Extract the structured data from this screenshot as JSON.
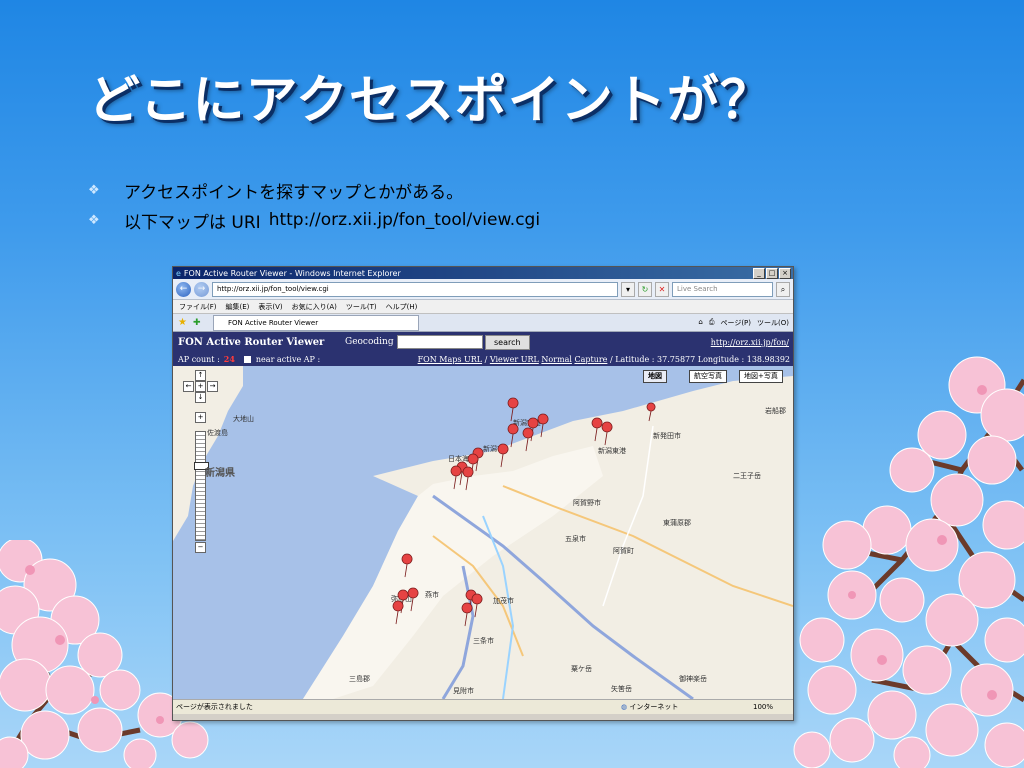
{
  "slide": {
    "title": "どこにアクセスポイントが？",
    "bullets": [
      {
        "text": "アクセスポイントを探すマップとかがある。"
      },
      {
        "text": "以下マップは URI",
        "link": "http://orz.xii.jp/fon_tool/view.cgi"
      }
    ]
  },
  "browser": {
    "window_title": "FON Active Router Viewer - Windows Internet Explorer",
    "address": "http://orz.xii.jp/fon_tool/view.cgi",
    "search_placeholder": "Live Search",
    "menu": [
      "ファイル(F)",
      "編集(E)",
      "表示(V)",
      "お気に入り(A)",
      "ツール(T)",
      "ヘルプ(H)"
    ],
    "tab_label": "FON Active Router Viewer",
    "command_bar": [
      "ページ(P)",
      "ツール(O)"
    ],
    "status_text": "ページが表示されました",
    "status_zone": "インターネット",
    "status_zoom": "100%"
  },
  "fon": {
    "title": "FON Active Router Viewer",
    "geocoding_label": "Geocoding :",
    "search_button": "search",
    "site_url": "http://orz.xii.jp/fon/",
    "ap_count_label": "AP count :",
    "ap_count": "24",
    "near_label": "near active AP :",
    "maps_url": "FON Maps URL",
    "viewer_url": "Viewer URL",
    "normal": "Normal",
    "capture": "Capture",
    "latitude": "Latitude : 37.75877",
    "longitude": "Longitude : 138.98392"
  },
  "map": {
    "type_buttons": [
      "地図",
      "航空写真",
      "地図+写真"
    ],
    "labels": [
      "大地山",
      "佐渡島",
      "新潟県",
      "日本海",
      "新潟空港",
      "新潟市",
      "新発田市",
      "岩船郡",
      "二王子岳",
      "新潟東港",
      "東蒲原郡",
      "阿賀野市",
      "五泉市",
      "阿賀町",
      "燕市",
      "加茂市",
      "弥彦山",
      "三条市",
      "見附市",
      "粟ケ岳",
      "矢筈岳",
      "御神楽岳",
      "三島郡"
    ],
    "colors": {
      "water": "#a7c1e8",
      "land": "#f2eee4",
      "pin": "#e64343",
      "highway": "#8fa6dc"
    }
  },
  "theme": {
    "slide_bg": "#2f8fe6",
    "header_bar": "#2b3270",
    "accent": "#ff3b3b"
  }
}
